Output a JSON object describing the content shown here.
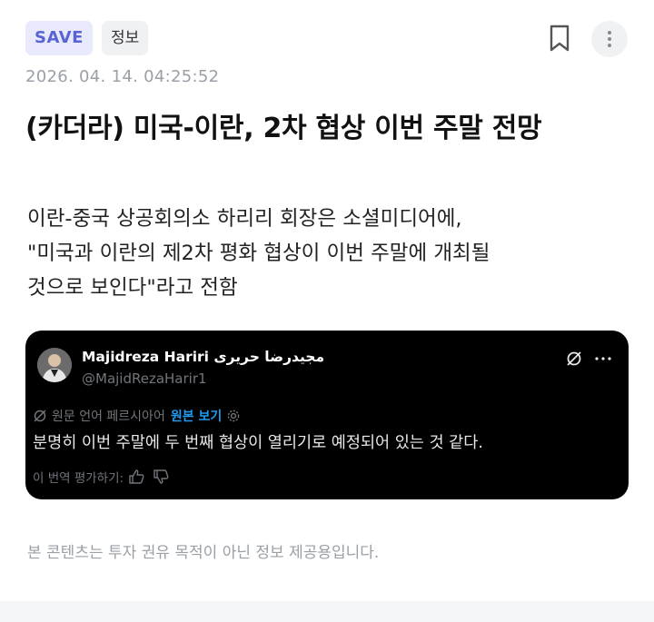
{
  "header": {
    "save_badge": "SAVE",
    "category_badge": "정보",
    "bookmark_icon": "bookmark-icon",
    "more_icon": "more-vertical-icon"
  },
  "article": {
    "timestamp": "2026. 04. 14. 04:25:52",
    "title": "(카더라) 미국-이란, 2차 협상 이번 주말 전망",
    "body_lines": [
      "이란-중국 상공회의소 하리리 회장은 소셜미디어에,",
      "\"미국과 이란의 제2차 평화 협상이 이번 주말에 개최될",
      "것으로 보인다\"라고 전함"
    ]
  },
  "tweet": {
    "display_name": "Majidreza Hariri مجیدرضا حریری",
    "handle": "@MajidRezaHarir1",
    "translated_from": "원문 언어 페르시아어",
    "show_original": "원본 보기",
    "text": "분명히 이번 주말에 두 번째 협상이 열리기로 예정되어 있는 것 같다.",
    "rate_translation": "이 번역 평가하기:",
    "colors": {
      "background": "#000000",
      "link": "#1d9bf0",
      "muted": "#71767b"
    }
  },
  "footer": {
    "disclaimer": "본 콘텐츠는 투자 권유 목적이 아닌 정보 제공용입니다."
  },
  "colors": {
    "save_badge_bg": "#e8eafb",
    "save_badge_text": "#5a63d6",
    "muted": "#9aa0a6"
  }
}
